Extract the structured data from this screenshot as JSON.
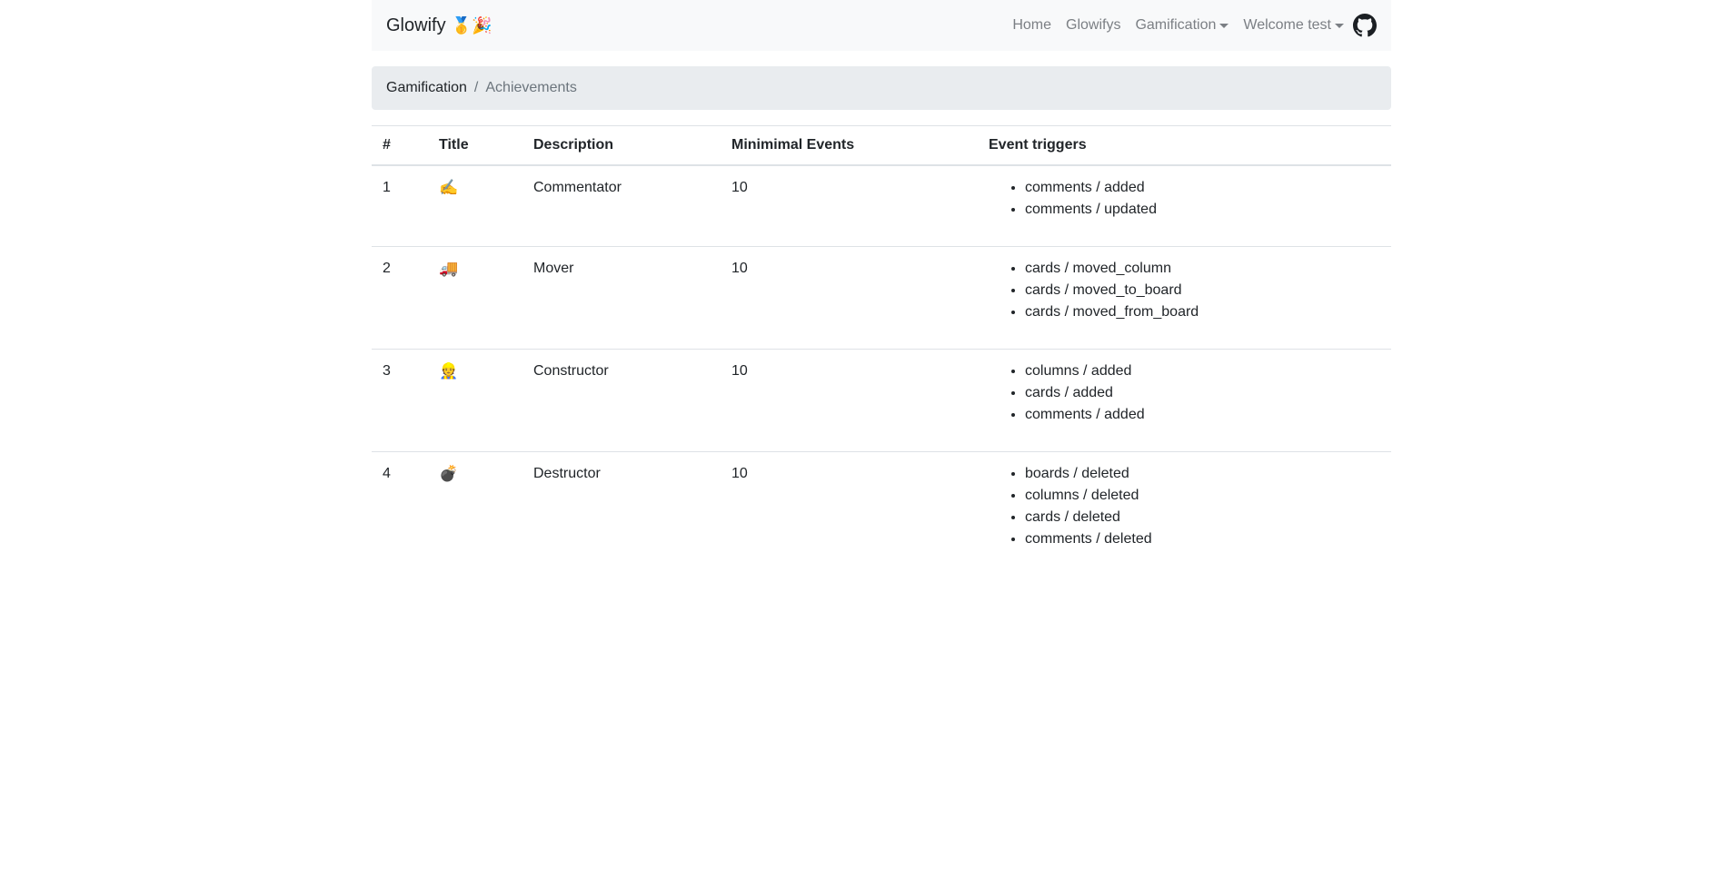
{
  "navbar": {
    "brand": "Glowify",
    "brand_emoji": "🥇🎉",
    "links": [
      {
        "label": "Home",
        "dropdown": false
      },
      {
        "label": "Glowifys",
        "dropdown": false
      },
      {
        "label": "Gamification",
        "dropdown": true
      },
      {
        "label": "Welcome test",
        "dropdown": true
      }
    ],
    "github_icon": "github-icon"
  },
  "breadcrumb": {
    "parent": "Gamification",
    "separator": "/",
    "current": "Achievements"
  },
  "table": {
    "headers": [
      "#",
      "Title",
      "Description",
      "Minimimal Events",
      "Event triggers"
    ],
    "rows": [
      {
        "id": "1",
        "title": "✍️",
        "description": "Commentator",
        "min_events": "10",
        "triggers": [
          "comments / added",
          "comments / updated"
        ]
      },
      {
        "id": "2",
        "title": "🚚",
        "description": "Mover",
        "min_events": "10",
        "triggers": [
          "cards / moved_column",
          "cards / moved_to_board",
          "cards / moved_from_board"
        ]
      },
      {
        "id": "3",
        "title": "👷",
        "description": "Constructor",
        "min_events": "10",
        "triggers": [
          "columns / added",
          "cards / added",
          "comments / added"
        ]
      },
      {
        "id": "4",
        "title": "💣",
        "description": "Destructor",
        "min_events": "10",
        "triggers": [
          "boards / deleted",
          "columns / deleted",
          "cards / deleted",
          "comments / deleted"
        ]
      }
    ]
  }
}
